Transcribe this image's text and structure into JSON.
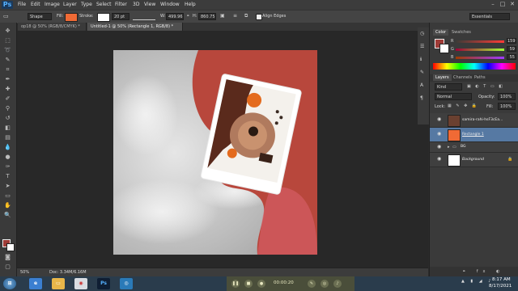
{
  "app": {
    "logo": "Ps"
  },
  "menu": [
    "File",
    "Edit",
    "Image",
    "Layer",
    "Type",
    "Select",
    "Filter",
    "3D",
    "View",
    "Window",
    "Help"
  ],
  "window_controls": {
    "minimize": "–",
    "maximize": "□",
    "close": "✕"
  },
  "options": {
    "mode": "Shape",
    "fill_label": "Fill:",
    "fill_color": "#f06a35",
    "stroke_label": "Stroke:",
    "stroke_size": "20 pt",
    "w_label": "W:",
    "w_value": "499.96",
    "h_label": "H:",
    "h_value": "860.75",
    "align_edges": "Align Edges",
    "workspace": "Essentials"
  },
  "tabs": [
    {
      "label": "op18 @ 50% (RGB/8/CMYK) *",
      "close": "×"
    },
    {
      "label": "Untitled-1 @ 50% (Rectangle 1, RGB/8) *",
      "close": "×"
    }
  ],
  "status": {
    "zoom": "50%",
    "doc": "Doc: 3.34M/6.16M"
  },
  "color_panel": {
    "tabs": [
      "Color",
      "Swatches"
    ],
    "r_label": "R",
    "r_value": "159",
    "g_label": "G",
    "g_value": "59",
    "b_label": "B",
    "b_value": "55",
    "foreground": "#9f3b37"
  },
  "layers_panel": {
    "tabs": [
      "Layers",
      "Channels",
      "Paths"
    ],
    "kind": "Kind",
    "blend_mode": "Normal",
    "opacity_label": "Opacity:",
    "opacity_value": "100%",
    "lock_label": "Lock:",
    "fill_label": "Fill:",
    "fill_value": "100%",
    "layers": [
      {
        "name": "samira-rahi-hsF3cEa...",
        "selected": false
      },
      {
        "name": "Rectangle 1",
        "selected": true
      },
      {
        "name": "BG",
        "selected": false
      },
      {
        "name": "Background",
        "selected": false
      }
    ]
  },
  "taskbar": {
    "time": "8:17 AM",
    "date": "8/17/2021",
    "recording_time": "00:00:20",
    "ps_label": "Ps"
  },
  "colors": {
    "accent": "#5679a3",
    "shape_red": "#b8473c",
    "fill_orange": "#f06a35"
  }
}
